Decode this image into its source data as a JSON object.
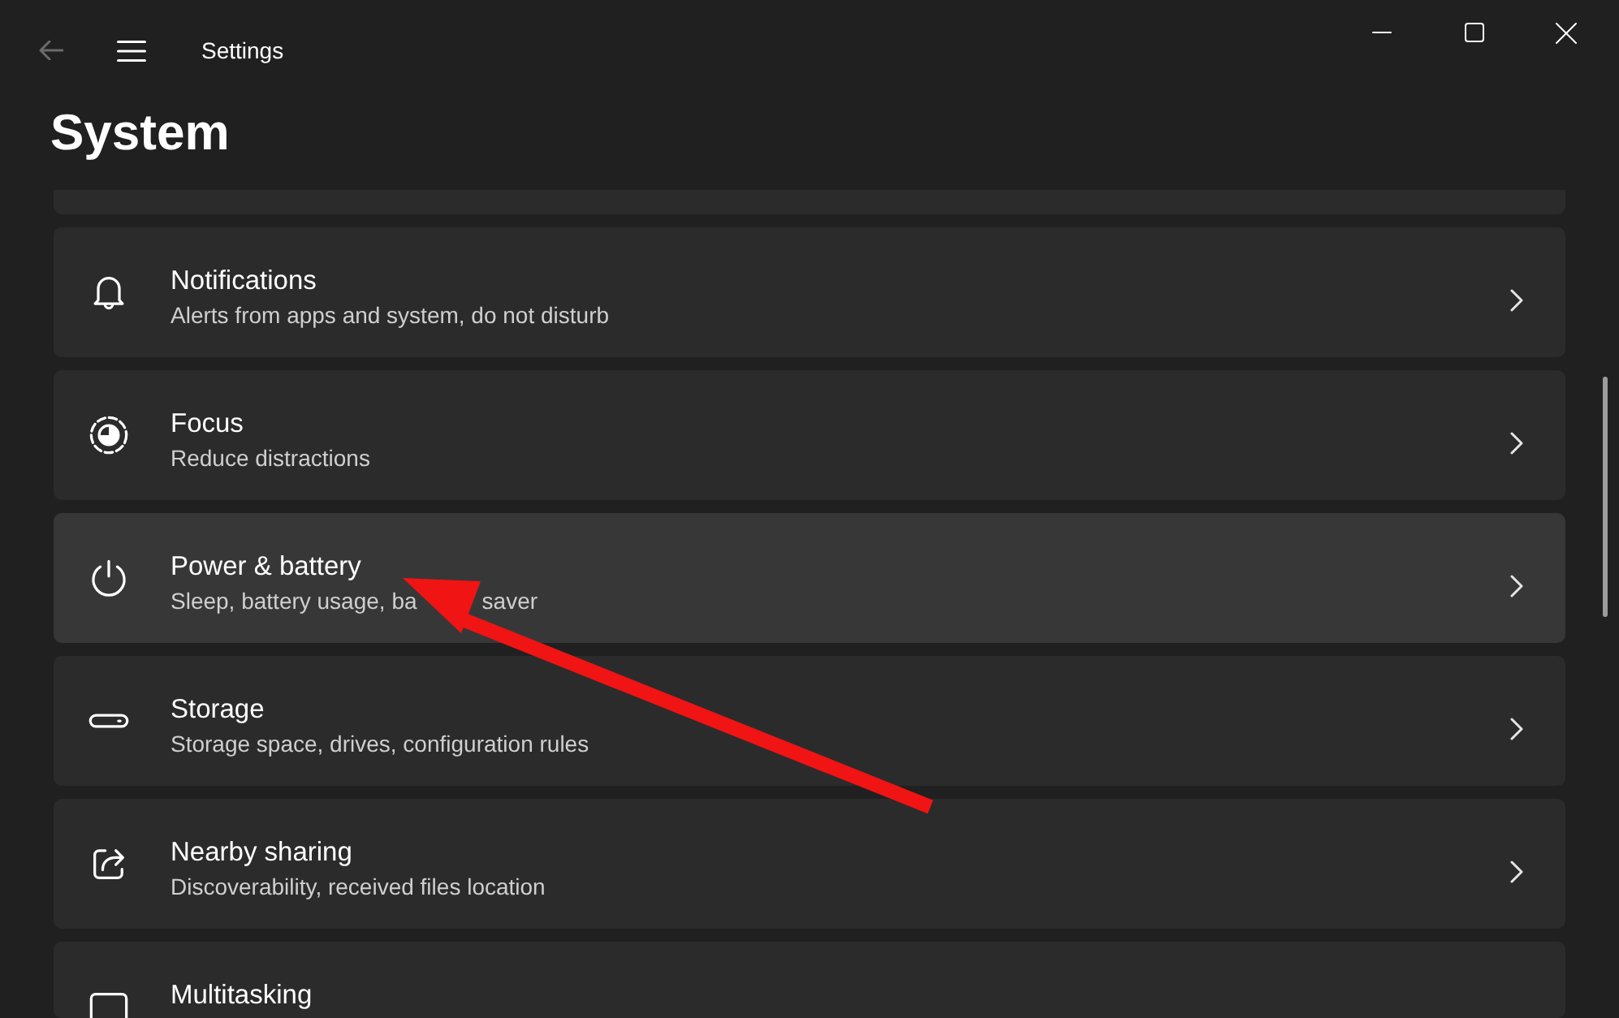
{
  "window": {
    "title": "Settings",
    "back_button": {
      "disabled": true
    }
  },
  "page": {
    "title": "System"
  },
  "settings_items": [
    {
      "title": "Notifications",
      "subtitle": "Alerts from apps and system, do not disturb",
      "hovered": false
    },
    {
      "title": "Focus",
      "subtitle": "Reduce distractions",
      "hovered": false
    },
    {
      "title": "Power & battery",
      "subtitle": "Sleep, battery usage, ba",
      "subtitle_tail": "saver",
      "hovered": true
    },
    {
      "title": "Storage",
      "subtitle": "Storage space, drives, configuration rules",
      "hovered": false
    },
    {
      "title": "Nearby sharing",
      "subtitle": "Discoverability, received files location",
      "hovered": false
    },
    {
      "title": "Multitasking",
      "hovered": false
    }
  ]
}
